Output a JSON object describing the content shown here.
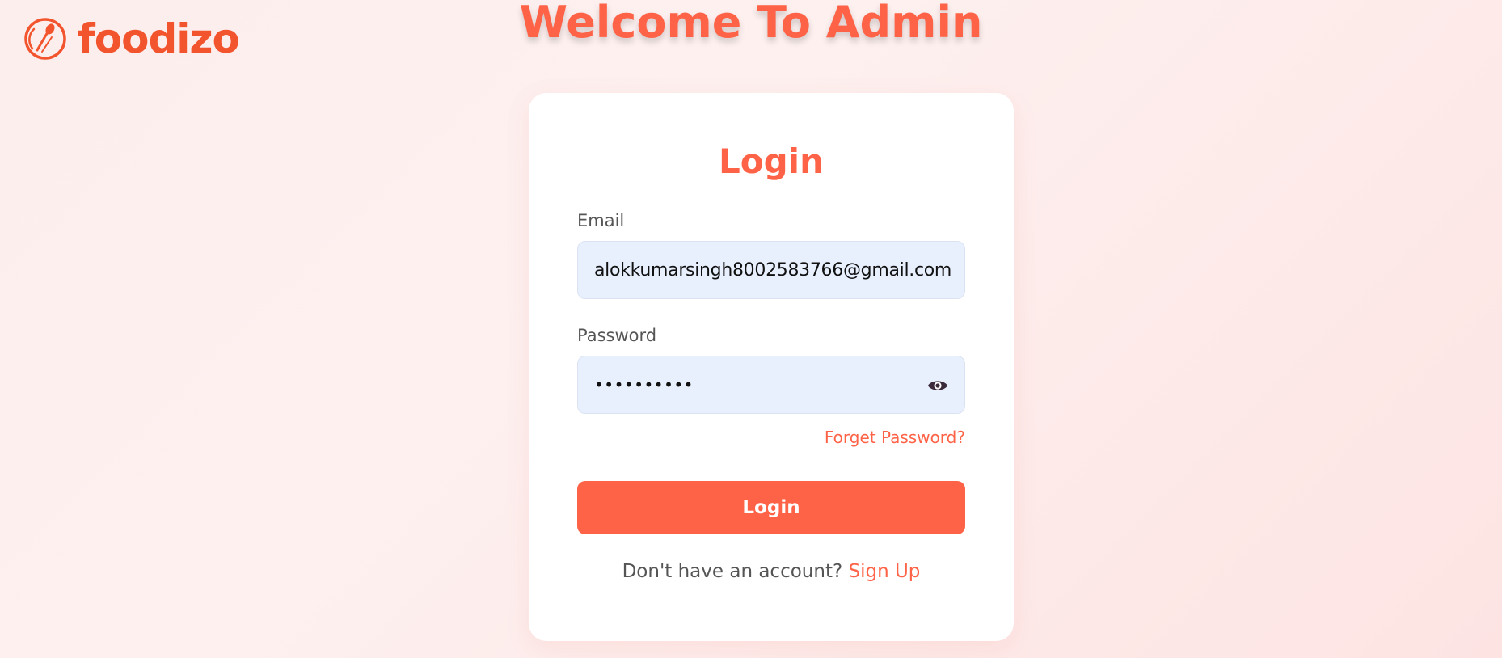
{
  "brand": {
    "name": "foodizo",
    "logo_icon": "fork-spoon-circle-icon",
    "color": "#f2542d"
  },
  "header": {
    "title": "Welcome To Admin"
  },
  "login_form": {
    "title": "Login",
    "email": {
      "label": "Email",
      "value": "alokkumarsingh8002583766@gmail.com"
    },
    "password": {
      "label": "Password",
      "masked_value": "••••••••••",
      "toggle_icon": "eye-icon"
    },
    "forget_password_label": "Forget Password?",
    "submit_label": "Login",
    "signup_prompt": "Don't have an account?",
    "signup_label": "Sign Up"
  },
  "colors": {
    "accent": "#ff6347",
    "input_bg": "#e8f0fe",
    "card_bg": "#ffffff"
  }
}
